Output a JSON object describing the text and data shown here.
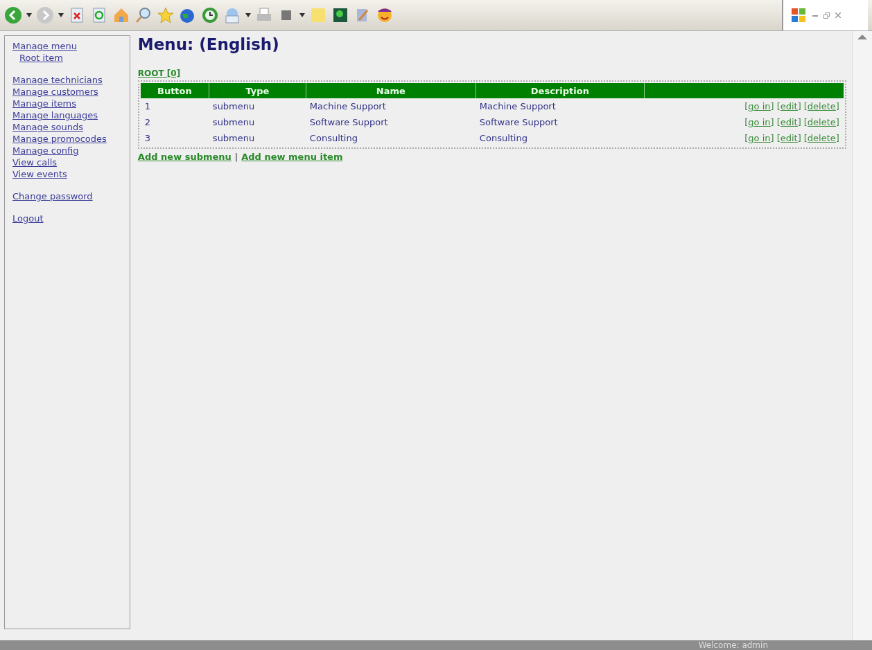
{
  "sidebar": {
    "groups": [
      [
        {
          "label": "Manage menu",
          "children": [
            {
              "label": "Root item"
            }
          ]
        }
      ],
      [
        {
          "label": "Manage technicians"
        },
        {
          "label": "Manage customers"
        },
        {
          "label": "Manage items"
        },
        {
          "label": "Manage languages"
        },
        {
          "label": "Manage sounds"
        },
        {
          "label": "Manage promocodes"
        },
        {
          "label": "Manage config"
        },
        {
          "label": "View calls"
        },
        {
          "label": "View events"
        }
      ],
      [
        {
          "label": "Change password"
        }
      ],
      [
        {
          "label": "Logout"
        }
      ]
    ]
  },
  "page": {
    "title": "Menu: (English)",
    "breadcrumb": "ROOT [0]"
  },
  "table": {
    "columns": [
      "Button",
      "Type",
      "Name",
      "Description",
      ""
    ],
    "rows": [
      {
        "button": "1",
        "type": "submenu",
        "name": "Machine Support",
        "description": "Machine Support",
        "actions": [
          "[go in]",
          "[edit]",
          "[delete]"
        ]
      },
      {
        "button": "2",
        "type": "submenu",
        "name": "Software Support",
        "description": "Software Support",
        "actions": [
          "[go in]",
          "[edit]",
          "[delete]"
        ]
      },
      {
        "button": "3",
        "type": "submenu",
        "name": "Consulting",
        "description": "Consulting",
        "actions": [
          "[go in]",
          "[edit]",
          "[delete]"
        ]
      }
    ]
  },
  "add_links": {
    "items": [
      "Add new submenu",
      "Add new menu item"
    ],
    "separator": "|"
  },
  "status_bar": {
    "text": "Welcome: admin"
  }
}
